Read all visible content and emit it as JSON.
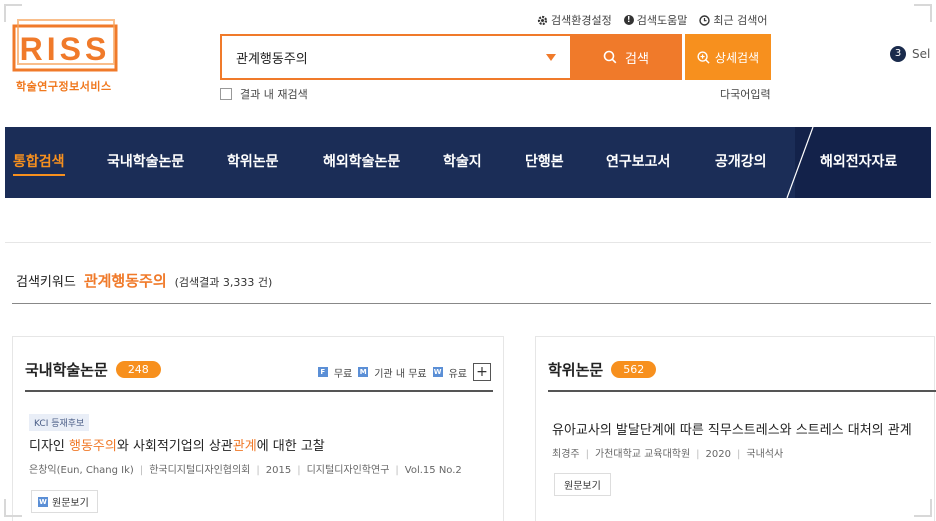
{
  "brand": {
    "logo_text": "RISS",
    "subtitle": "학술연구정보서비스"
  },
  "util_links": [
    {
      "label": "검색환경설정",
      "icon": "gear-icon"
    },
    {
      "label": "검색도움말",
      "icon": "info-icon"
    },
    {
      "label": "최근 검색어",
      "icon": "clock-icon"
    }
  ],
  "search": {
    "value": "관계행동주의",
    "button": "검색",
    "advanced": "상세검색",
    "within_results": "결과 내 재검색",
    "multilang": "다국어입력"
  },
  "selection": {
    "count": "3",
    "label": "Sel"
  },
  "nav": [
    {
      "label": "통합검색",
      "active": true
    },
    {
      "label": "국내학술논문"
    },
    {
      "label": "학위논문"
    },
    {
      "label": "해외학술논문"
    },
    {
      "label": "학술지"
    },
    {
      "label": "단행본"
    },
    {
      "label": "연구보고서"
    },
    {
      "label": "공개강의"
    },
    {
      "label": "해외전자자료"
    }
  ],
  "keyword": {
    "label": "검색키워드",
    "term": "관계행동주의",
    "count_text": "(검색결과 3,333 건)"
  },
  "left_panel": {
    "title": "국내학술논문",
    "count": "248",
    "legend": [
      {
        "icon": "F",
        "label": "무료"
      },
      {
        "icon": "M",
        "label": "기관 내 무료"
      },
      {
        "icon": "W",
        "label": "유료"
      }
    ],
    "more": "+",
    "article": {
      "badge": "KCI 등재후보",
      "title_parts": [
        "디자인 ",
        "행동주의",
        "와 사회적기업의 상관",
        "관계",
        "에 대한 고찰"
      ],
      "meta": [
        "은창익(Eun, Chang Ik)",
        "한국디지털디자인협의회",
        "2015",
        "디지털디자인학연구",
        "Vol.15 No.2"
      ],
      "view_button": "원문보기"
    }
  },
  "right_panel": {
    "title": "학위논문",
    "count": "562",
    "item": {
      "title": "유아교사의 발달단계에 따른 직무스트레스와 스트레스 대처의 관계",
      "meta": [
        "최경주",
        "가천대학교 교육대학원",
        "2020",
        "국내석사"
      ],
      "view_button": "원문보기"
    }
  },
  "colors": {
    "accent": "#f07a2a",
    "accent_light": "#f7901e",
    "nav_bg": "#1b2d57"
  }
}
